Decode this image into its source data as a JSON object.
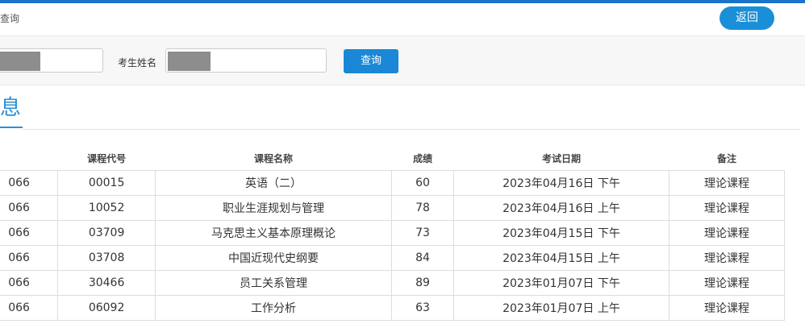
{
  "header": {
    "breadcrumb": "查询",
    "back_label": "返回"
  },
  "search": {
    "name_label": "考生姓名",
    "query_label": "查询"
  },
  "section": {
    "title": "息"
  },
  "table": {
    "columns": [
      "课程代号",
      "课程名称",
      "成绩",
      "考试日期",
      "备注"
    ],
    "rows": [
      {
        "prefix": "066",
        "code": "00015",
        "name": "英语（二）",
        "score": "60",
        "date": "2023年04月16日 下午",
        "note": "理论课程"
      },
      {
        "prefix": "066",
        "code": "10052",
        "name": "职业生涯规划与管理",
        "score": "78",
        "date": "2023年04月16日 上午",
        "note": "理论课程"
      },
      {
        "prefix": "066",
        "code": "03709",
        "name": "马克思主义基本原理概论",
        "score": "73",
        "date": "2023年04月15日 下午",
        "note": "理论课程"
      },
      {
        "prefix": "066",
        "code": "03708",
        "name": "中国近现代史纲要",
        "score": "84",
        "date": "2023年04月15日 上午",
        "note": "理论课程"
      },
      {
        "prefix": "066",
        "code": "30466",
        "name": "员工关系管理",
        "score": "89",
        "date": "2023年01月07日 下午",
        "note": "理论课程"
      },
      {
        "prefix": "066",
        "code": "06092",
        "name": "工作分析",
        "score": "63",
        "date": "2023年01月07日 上午",
        "note": "理论课程"
      }
    ]
  }
}
